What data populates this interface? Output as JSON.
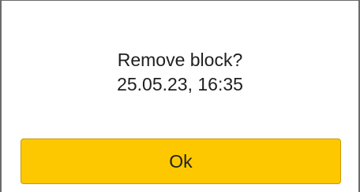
{
  "dialog": {
    "question": "Remove block?",
    "timestamp": "25.05.23, 16:35",
    "ok_label": "Ok"
  },
  "colors": {
    "button_fill": "#fdc800",
    "border": "#6b6b6b",
    "text": "#1f1f1f"
  }
}
